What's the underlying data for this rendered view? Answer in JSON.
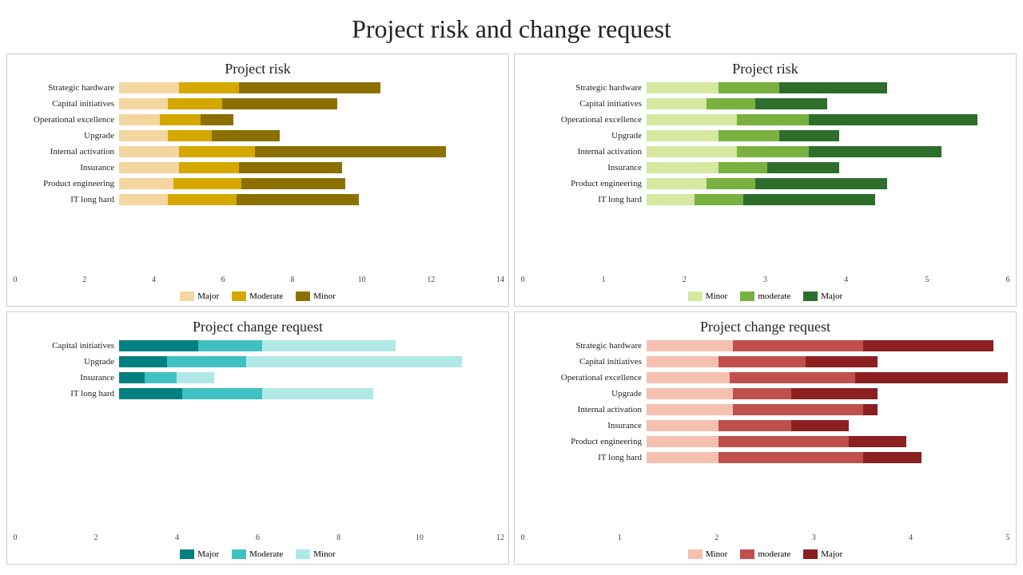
{
  "title": "Project risk and change request",
  "charts": [
    {
      "id": "top-left",
      "title": "Project risk",
      "type": "horizontal-bar",
      "xMax": 14,
      "xTicks": [
        0,
        2,
        4,
        6,
        8,
        10,
        12,
        14
      ],
      "legend": [
        {
          "label": "Major",
          "color": "#f5d5a0"
        },
        {
          "label": "Moderate",
          "color": "#d4a800"
        },
        {
          "label": "Minor",
          "color": "#8b7000"
        }
      ],
      "categories": [
        {
          "label": "Strategic hardware",
          "values": [
            2.2,
            2.2,
            5.2
          ]
        },
        {
          "label": "Capital initiatives",
          "values": [
            1.8,
            2.0,
            4.2
          ]
        },
        {
          "label": "Operational excellence",
          "values": [
            1.5,
            1.5,
            1.2
          ]
        },
        {
          "label": "Upgrade",
          "values": [
            1.8,
            1.6,
            2.5
          ]
        },
        {
          "label": "Internal activation",
          "values": [
            2.2,
            2.8,
            7.0
          ]
        },
        {
          "label": "Insurance",
          "values": [
            2.2,
            2.2,
            3.8
          ]
        },
        {
          "label": "Product engineering",
          "values": [
            2.0,
            2.5,
            3.8
          ]
        },
        {
          "label": "IT long hard",
          "values": [
            1.8,
            2.5,
            4.5
          ]
        }
      ],
      "colors": [
        "#f5d5a0",
        "#d4a800",
        "#8b7000"
      ]
    },
    {
      "id": "top-right",
      "title": "Project risk",
      "type": "horizontal-bar",
      "xMax": 6,
      "xTicks": [
        0,
        1,
        2,
        3,
        4,
        5,
        6
      ],
      "legend": [
        {
          "label": "Minor",
          "color": "#d4e8a0"
        },
        {
          "label": "moderate",
          "color": "#7ab040"
        },
        {
          "label": "Major",
          "color": "#2d6e2d"
        }
      ],
      "categories": [
        {
          "label": "Strategic hardware",
          "values": [
            1.2,
            1.0,
            1.8
          ]
        },
        {
          "label": "Capital initiatives",
          "values": [
            1.0,
            0.8,
            1.2
          ]
        },
        {
          "label": "Operational excellence",
          "values": [
            1.5,
            1.2,
            2.8
          ]
        },
        {
          "label": "Upgrade",
          "values": [
            1.2,
            1.0,
            1.0
          ]
        },
        {
          "label": "Internal activation",
          "values": [
            1.5,
            1.2,
            2.2
          ]
        },
        {
          "label": "Insurance",
          "values": [
            1.2,
            0.8,
            1.2
          ]
        },
        {
          "label": "Product engineering",
          "values": [
            1.0,
            0.8,
            2.2
          ]
        },
        {
          "label": "IT long hard",
          "values": [
            0.8,
            0.8,
            2.2
          ]
        }
      ],
      "colors": [
        "#d4e8a0",
        "#7ab040",
        "#2d6e2d"
      ]
    },
    {
      "id": "bottom-left",
      "title": "Project change request",
      "type": "horizontal-bar",
      "xMax": 12,
      "xTicks": [
        0,
        2,
        4,
        6,
        8,
        10,
        12
      ],
      "legend": [
        {
          "label": "Major",
          "color": "#008080"
        },
        {
          "label": "Moderate",
          "color": "#40c0c0"
        },
        {
          "label": "Minor",
          "color": "#b0e8e8"
        }
      ],
      "categories": [
        {
          "label": "Capital initiatives",
          "values": [
            2.5,
            2.0,
            4.2
          ]
        },
        {
          "label": "Upgrade",
          "values": [
            1.5,
            2.5,
            6.8
          ]
        },
        {
          "label": "Insurance",
          "values": [
            0.8,
            1.0,
            1.2
          ]
        },
        {
          "label": "IT long hard",
          "values": [
            2.0,
            2.5,
            3.5
          ]
        }
      ],
      "colors": [
        "#008080",
        "#40c0c0",
        "#b0e8e8"
      ]
    },
    {
      "id": "bottom-right",
      "title": "Project change request",
      "type": "horizontal-bar",
      "xMax": 5,
      "xTicks": [
        0,
        1,
        2,
        3,
        4,
        5
      ],
      "legend": [
        {
          "label": "Minor",
          "color": "#f5c0b0"
        },
        {
          "label": "moderate",
          "color": "#c0504d"
        },
        {
          "label": "Major",
          "color": "#8b2020"
        }
      ],
      "categories": [
        {
          "label": "Strategic hardware",
          "values": [
            1.2,
            1.8,
            1.8
          ]
        },
        {
          "label": "Capital initiatives",
          "values": [
            1.0,
            1.2,
            1.0
          ]
        },
        {
          "label": "Operational excellence",
          "values": [
            1.2,
            1.8,
            2.2
          ]
        },
        {
          "label": "Upgrade",
          "values": [
            1.2,
            0.8,
            1.2
          ]
        },
        {
          "label": "Internal activation",
          "values": [
            1.2,
            1.8,
            0.2
          ]
        },
        {
          "label": "Insurance",
          "values": [
            1.0,
            1.0,
            0.8
          ]
        },
        {
          "label": "Product engineering",
          "values": [
            1.0,
            1.8,
            0.8
          ]
        },
        {
          "label": "IT long hard",
          "values": [
            1.0,
            2.0,
            0.8
          ]
        }
      ],
      "colors": [
        "#f5c0b0",
        "#c0504d",
        "#8b2020"
      ]
    }
  ]
}
